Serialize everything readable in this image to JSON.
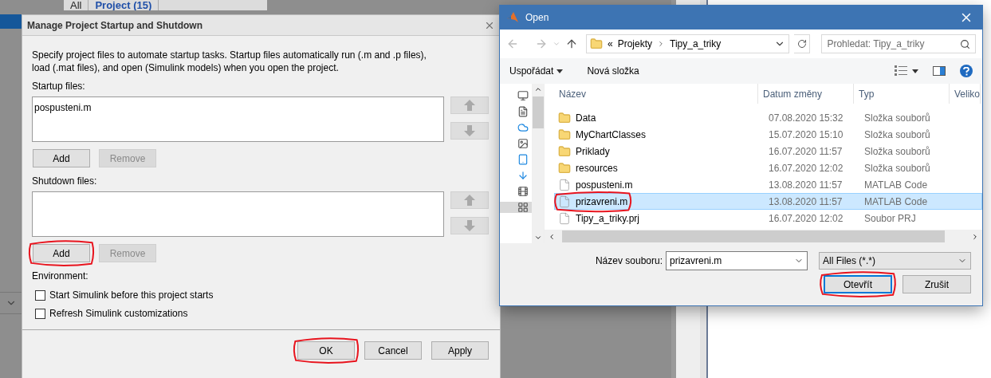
{
  "background": {
    "tabs": [
      {
        "label": "All",
        "selected": false
      },
      {
        "label": "Project (15)",
        "selected": true
      }
    ]
  },
  "manage_dialog": {
    "title": "Manage Project Startup and Shutdown",
    "description": "Specify project files to automate startup tasks. Startup files automatically run (.m and .p files), load (.mat files), and open (Simulink models) when you open the project.",
    "startup_label": "Startup files:",
    "startup_files": [
      "pospusteni.m"
    ],
    "startup_buttons": [
      {
        "label": "Add",
        "disabled": false,
        "circled": false
      },
      {
        "label": "Remove",
        "disabled": true,
        "circled": false
      }
    ],
    "shutdown_label": "Shutdown files:",
    "shutdown_buttons": [
      {
        "label": "Add",
        "disabled": false,
        "circled": true
      },
      {
        "label": "Remove",
        "disabled": true,
        "circled": false
      }
    ],
    "environment_label": "Environment:",
    "options": [
      {
        "label": "Start Simulink before this project starts",
        "checked": false
      },
      {
        "label": "Refresh Simulink customizations",
        "checked": false
      }
    ],
    "buttons": [
      {
        "label": "OK",
        "circled": true
      },
      {
        "label": "Cancel",
        "circled": false
      },
      {
        "label": "Apply",
        "circled": false
      }
    ]
  },
  "open_dialog": {
    "title": "Open",
    "path_overflow": "«",
    "path": [
      "Projekty",
      "Tipy_a_triky"
    ],
    "search": {
      "placeholder": "Prohledat: Tipy_a_triky"
    },
    "toolbar": [
      {
        "label": "Uspořádat",
        "dropdown": true
      },
      {
        "label": "Nová složka",
        "dropdown": false
      }
    ],
    "columns": [
      "Název",
      "Datum změny",
      "Typ",
      "Veliko"
    ],
    "files": [
      {
        "kind": "folder",
        "name": "Data",
        "date": "07.08.2020 15:32",
        "type": "Složka souborů",
        "selected": false,
        "circled": false
      },
      {
        "kind": "folder",
        "name": "MyChartClasses",
        "date": "15.07.2020 15:10",
        "type": "Složka souborů",
        "selected": false,
        "circled": false
      },
      {
        "kind": "folder",
        "name": "Priklady",
        "date": "16.07.2020 11:57",
        "type": "Složka souborů",
        "selected": false,
        "circled": false
      },
      {
        "kind": "folder",
        "name": "resources",
        "date": "16.07.2020 12:02",
        "type": "Složka souborů",
        "selected": false,
        "circled": false
      },
      {
        "kind": "file",
        "name": "pospusteni.m",
        "date": "13.08.2020 11:57",
        "type": "MATLAB Code",
        "selected": false,
        "circled": false
      },
      {
        "kind": "file",
        "name": "prizavreni.m",
        "date": "13.08.2020 11:57",
        "type": "MATLAB Code",
        "selected": true,
        "circled": true
      },
      {
        "kind": "file",
        "name": "Tipy_a_triky.prj",
        "date": "16.07.2020 12:02",
        "type": "Soubor PRJ",
        "selected": false,
        "circled": false
      }
    ],
    "filename_label": "Název souboru:",
    "filename": "prizavreni.m",
    "filter": "All Files (*.*)",
    "buttons": [
      {
        "label": "Otevřít",
        "default": true,
        "circled": true
      },
      {
        "label": "Zrušit",
        "default": false,
        "circled": false
      }
    ]
  }
}
